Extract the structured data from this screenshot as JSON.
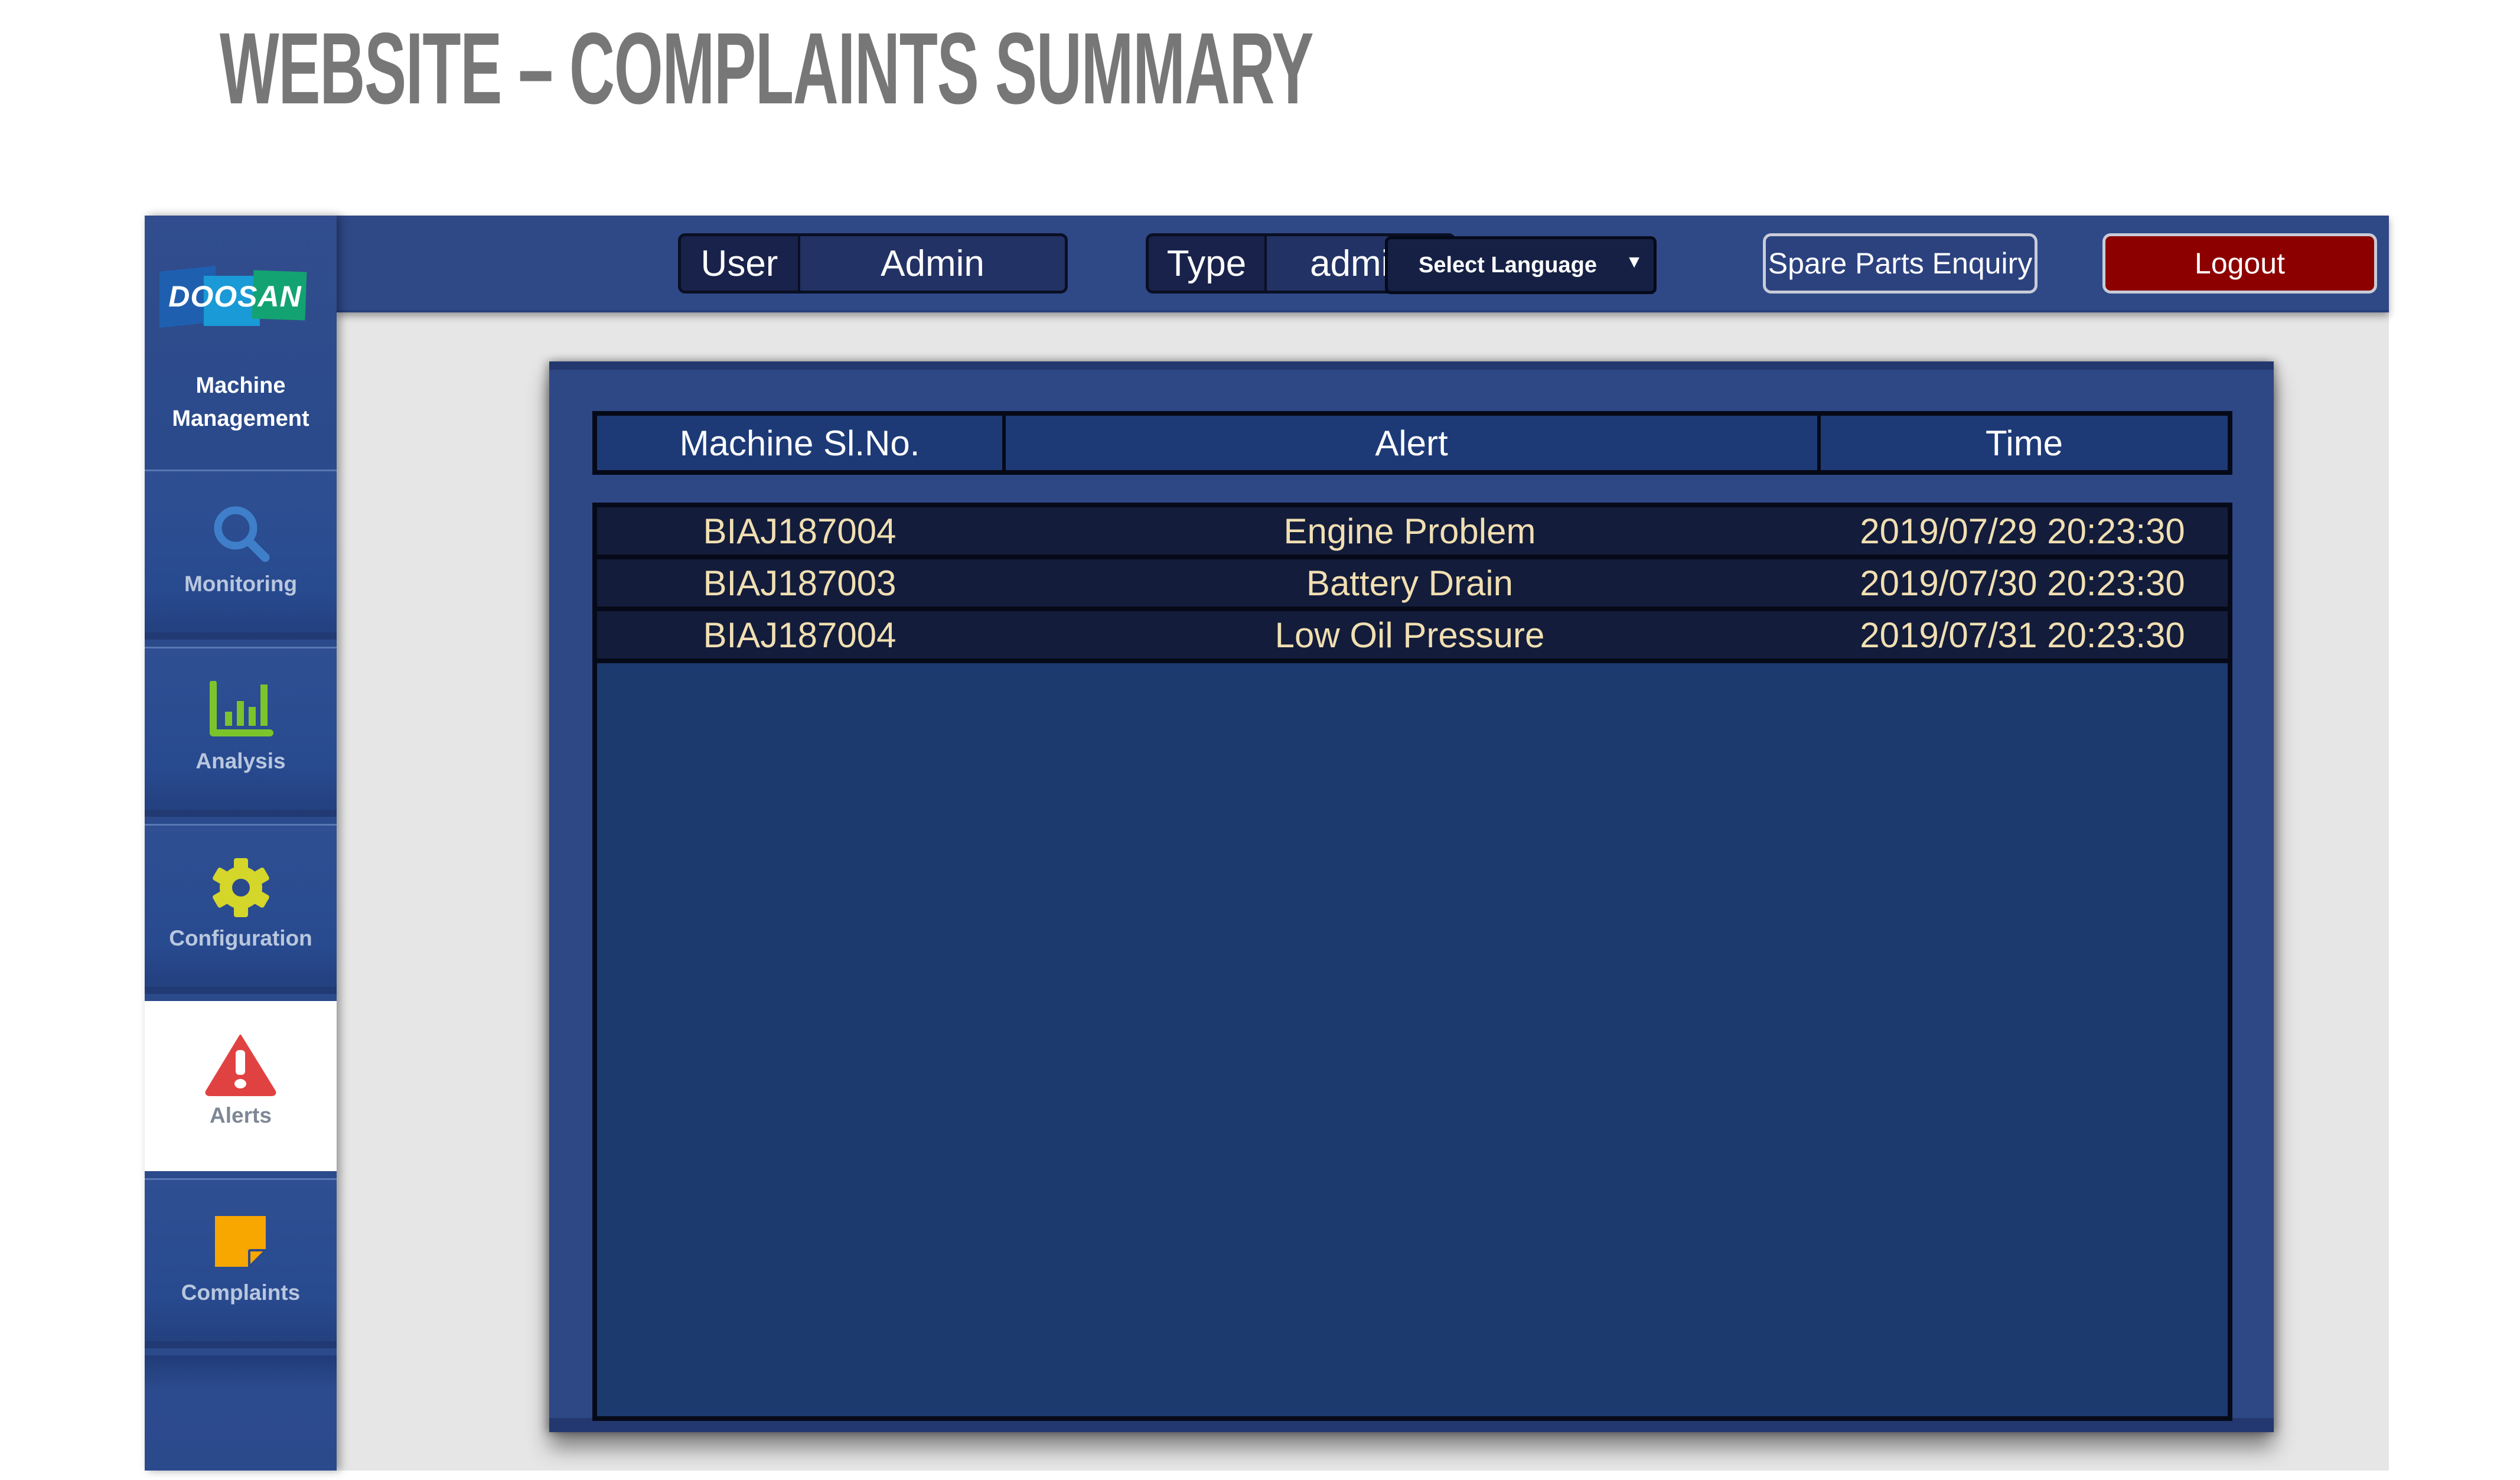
{
  "slide": {
    "title": "WEBSITE – COMPLAINTS SUMMARY"
  },
  "sidebar": {
    "logo_text": "DOOSAN",
    "header_label": "Machine Management",
    "items": [
      {
        "label": "Monitoring",
        "icon": "search-icon",
        "color": "#3f7fc9",
        "active": false
      },
      {
        "label": "Analysis",
        "icon": "bar-chart-icon",
        "color": "#7cc42c",
        "active": false
      },
      {
        "label": "Configuration",
        "icon": "gear-icon",
        "color": "#d4d62a",
        "active": false
      },
      {
        "label": "Alerts",
        "icon": "warning-triangle-icon",
        "color": "#e04242",
        "active": true
      },
      {
        "label": "Complaints",
        "icon": "sticky-note-icon",
        "color": "#f8a600",
        "active": false
      }
    ]
  },
  "topbar": {
    "user_label": "User",
    "user_value": "Admin",
    "type_label": "Type",
    "type_value": "admin",
    "language_select": "Select Language",
    "spare_parts_button": "Spare Parts Enquiry",
    "logout_button": "Logout",
    "logout_color": "#8c0000"
  },
  "table": {
    "columns": [
      "Machine Sl.No.",
      "Alert",
      "Time"
    ],
    "rows": [
      {
        "machine": "BIAJ187004",
        "alert": "Engine Problem",
        "time": "2019/07/29 20:23:30"
      },
      {
        "machine": "BIAJ187003",
        "alert": "Battery Drain",
        "time": "2019/07/30 20:23:30"
      },
      {
        "machine": "BIAJ187004",
        "alert": "Low Oil Pressure",
        "time": "2019/07/31 20:23:30"
      }
    ]
  }
}
